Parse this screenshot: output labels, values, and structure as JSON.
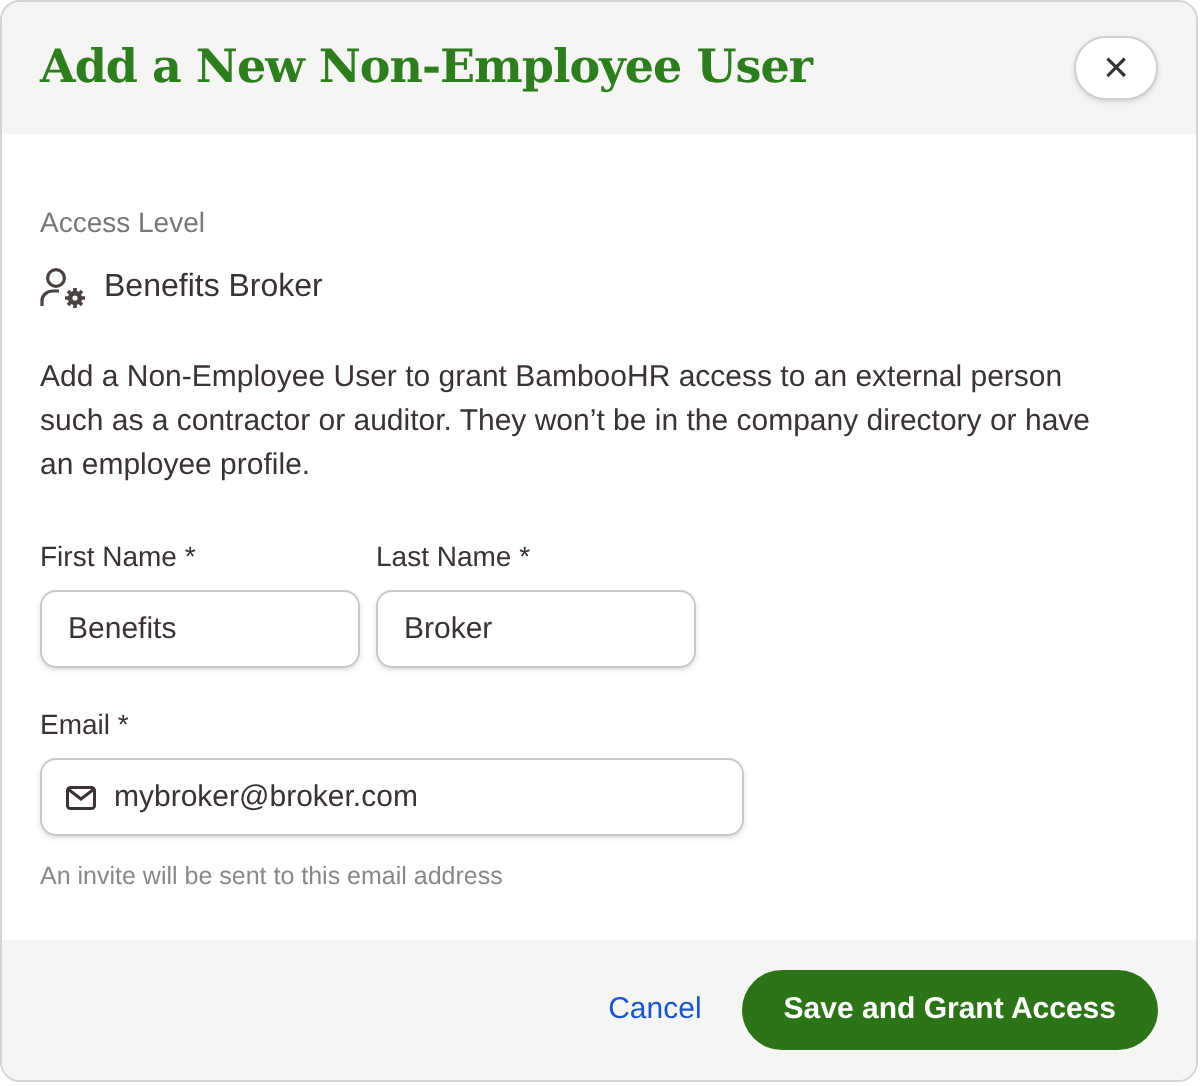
{
  "dialog": {
    "title": "Add a New Non-Employee User",
    "close_label": "×"
  },
  "access_level": {
    "label": "Access Level",
    "value": "Benefits Broker"
  },
  "description": "Add a Non-Employee User to grant BambooHR access to an external person such as a contractor or auditor. They won’t be in the company directory or have an employee profile.",
  "name_fields": [
    {
      "label": "First Name *",
      "value": "Benefits"
    },
    {
      "label": "Last Name *",
      "value": "Broker"
    }
  ],
  "email_field": {
    "label": "Email *",
    "value": "mybroker@broker.com",
    "hint": "An invite will be sent to this email address"
  },
  "buttons": [
    {
      "kind": "link",
      "label": "Cancel"
    },
    {
      "kind": "primary",
      "label": "Save and Grant Access"
    }
  ]
}
